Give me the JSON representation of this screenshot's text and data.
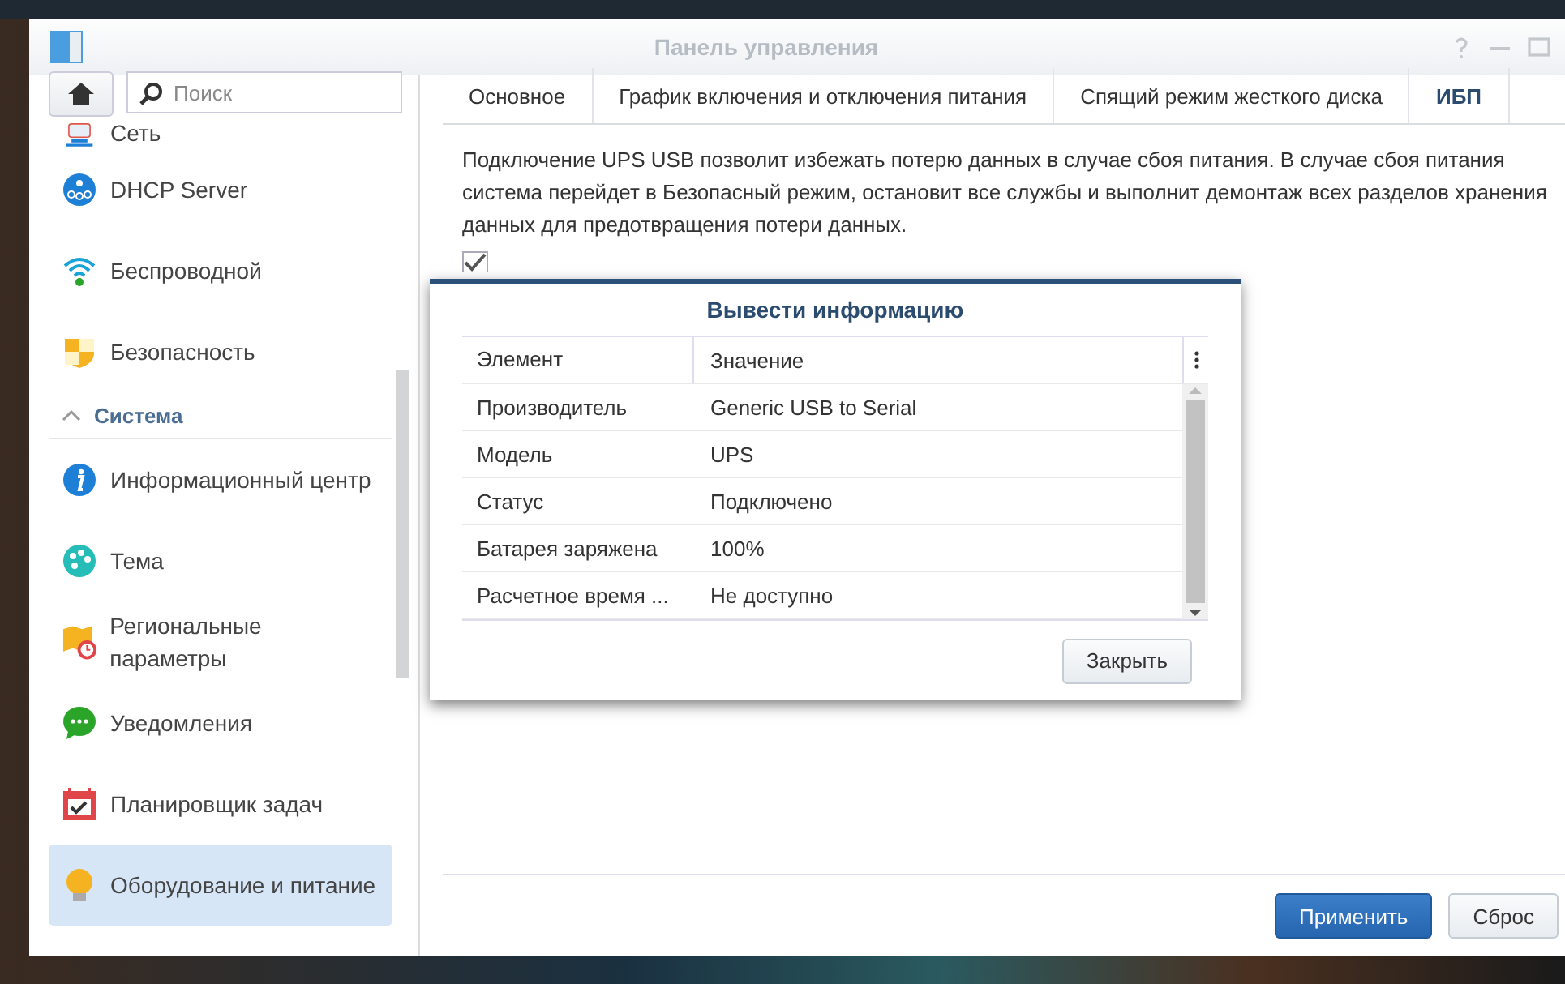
{
  "window": {
    "title": "Панель управления"
  },
  "sidebar": {
    "search": {
      "placeholder": "Поиск"
    },
    "items": [
      {
        "label": "Сеть",
        "selected": false
      },
      {
        "label": "DHCP Server",
        "selected": false
      },
      {
        "label": "Беспроводной",
        "selected": false
      },
      {
        "label": "Безопасность",
        "selected": false
      }
    ],
    "section": {
      "label": "Система",
      "expanded": true,
      "items": [
        {
          "label": "Информационный центр",
          "selected": false
        },
        {
          "label": "Тема",
          "selected": false
        },
        {
          "label": "Региональные параметры",
          "selected": false
        },
        {
          "label": "Уведомления",
          "selected": false
        },
        {
          "label": "Планировщик задач",
          "selected": false
        },
        {
          "label": "Оборудование и питание",
          "selected": true
        }
      ]
    }
  },
  "tabs": [
    {
      "label": "Основное",
      "selected": false
    },
    {
      "label": "График включения и отключения питания",
      "selected": false
    },
    {
      "label": "Спящий режим жесткого диска",
      "selected": false
    },
    {
      "label": "ИБП",
      "selected": true
    }
  ],
  "description": "Подключение UPS USB позволит избежать потерю данных в случае сбоя питания. В случае сбоя питания система перейдет в Безопасный режим, остановит все службы и выполнит демонтаж всех разделов хранения данных для предотвращения потери данных.",
  "ups_checkbox": {
    "checked": true
  },
  "footer_buttons": [
    {
      "label": "Применить",
      "kind": "primary"
    },
    {
      "label": "Сброс",
      "kind": "secondary"
    }
  ],
  "dialog": {
    "title": "Вывести информацию",
    "columns": [
      "Элемент",
      "Значение"
    ],
    "rows": [
      [
        "Производитель",
        "Generic USB to Serial"
      ],
      [
        "Модель",
        "UPS"
      ],
      [
        "Статус",
        "Подключено"
      ],
      [
        "Батарея заряжена",
        "100%"
      ],
      [
        "Расчетное время ...",
        "Не доступно"
      ]
    ],
    "close_button": "Закрыть"
  }
}
